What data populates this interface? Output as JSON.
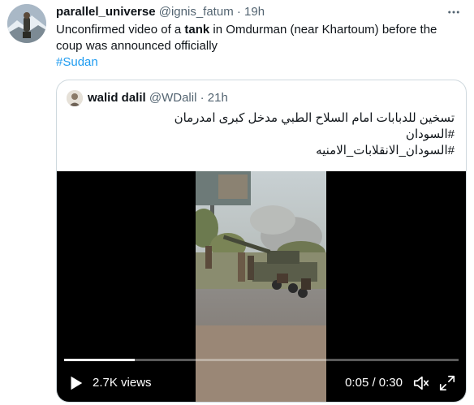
{
  "tweet": {
    "display_name": "parallel_universe",
    "handle": "@ignis_fatum",
    "separator": "·",
    "time": "19h",
    "text_before": "Unconfirmed video of a ",
    "text_bold": "tank",
    "text_after": " in Omdurman (near Khartoum) before the coup was announced officially",
    "hashtag": "#Sudan",
    "more_icon": "more-horizontal-icon"
  },
  "quoted": {
    "display_name": "walid dalil",
    "handle": "@WDalil",
    "separator": "·",
    "time": "21h",
    "lines": [
      "تسخين للدبابات امام السلاح الطبي مدخل كبرى امدرمان",
      "#السودان",
      "#السودان_الانقلابات_الامنيه"
    ]
  },
  "video": {
    "views": "2.7K views",
    "time_readout": "0:05 / 0:30",
    "progress_fraction": 0.18,
    "icons": {
      "play": "play-icon",
      "volume": "volume-icon",
      "fullscreen": "fullscreen-icon"
    }
  }
}
